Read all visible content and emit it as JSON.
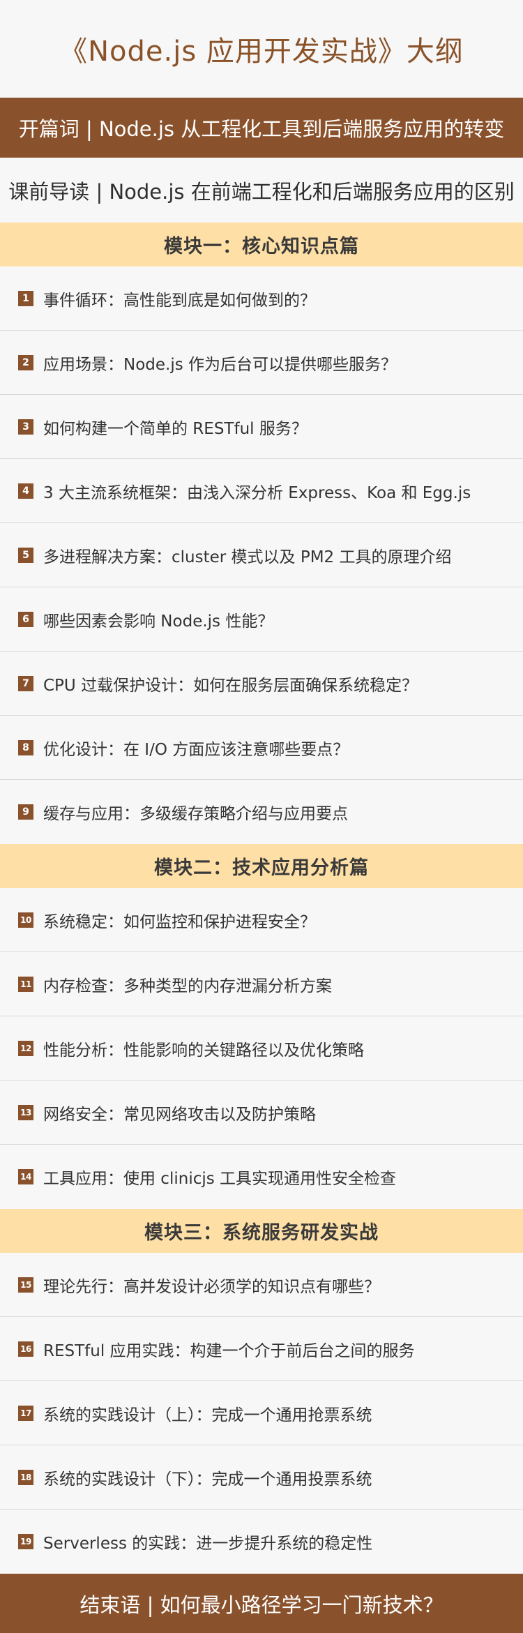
{
  "title": "《Node.js 应用开发实战》大纲",
  "intro": "开篇词 | Node.js 从工程化工具到后端服务应用的转变",
  "guide": "课前导读 | Node.js 在前端工程化和后端服务应用的区别",
  "modules": [
    {
      "name": "模块一：核心知识点篇",
      "lessons": [
        {
          "num": "1",
          "text": "事件循环：高性能到底是如何做到的？"
        },
        {
          "num": "2",
          "text": "应用场景：Node.js 作为后台可以提供哪些服务？"
        },
        {
          "num": "3",
          "text": "如何构建一个简单的 RESTful 服务？"
        },
        {
          "num": "4",
          "text": "3 大主流系统框架：由浅入深分析 Express、Koa 和 Egg.js"
        },
        {
          "num": "5",
          "text": "多进程解决方案：cluster 模式以及 PM2 工具的原理介绍"
        },
        {
          "num": "6",
          "text": "哪些因素会影响 Node.js 性能？"
        },
        {
          "num": "7",
          "text": "CPU 过载保护设计：如何在服务层面确保系统稳定？"
        },
        {
          "num": "8",
          "text": "优化设计：在 I/O 方面应该注意哪些要点？"
        },
        {
          "num": "9",
          "text": "缓存与应用：多级缓存策略介绍与应用要点"
        }
      ]
    },
    {
      "name": "模块二：技术应用分析篇",
      "lessons": [
        {
          "num": "10",
          "text": "系统稳定：如何监控和保护进程安全？"
        },
        {
          "num": "11",
          "text": "内存检查：多种类型的内存泄漏分析方案"
        },
        {
          "num": "12",
          "text": "性能分析：性能影响的关键路径以及优化策略"
        },
        {
          "num": "13",
          "text": "网络安全：常见网络攻击以及防护策略"
        },
        {
          "num": "14",
          "text": "工具应用：使用 clinicjs 工具实现通用性安全检查"
        }
      ]
    },
    {
      "name": "模块三：系统服务研发实战",
      "lessons": [
        {
          "num": "15",
          "text": "理论先行：高并发设计必须学的知识点有哪些？"
        },
        {
          "num": "16",
          "text": "RESTful 应用实践：构建一个介于前后台之间的服务"
        },
        {
          "num": "17",
          "text": "系统的实践设计（上）：完成一个通用抢票系统"
        },
        {
          "num": "18",
          "text": "系统的实践设计（下）：完成一个通用投票系统"
        },
        {
          "num": "19",
          "text": "Serverless 的实践：进一步提升系统的稳定性"
        }
      ]
    }
  ],
  "outro": "结束语 | 如何最小路径学习一门新技术？",
  "colors": {
    "accent_brown": "#8a522c",
    "module_header_bg": "#fedfa6",
    "page_bg": "#f7f7f7"
  }
}
